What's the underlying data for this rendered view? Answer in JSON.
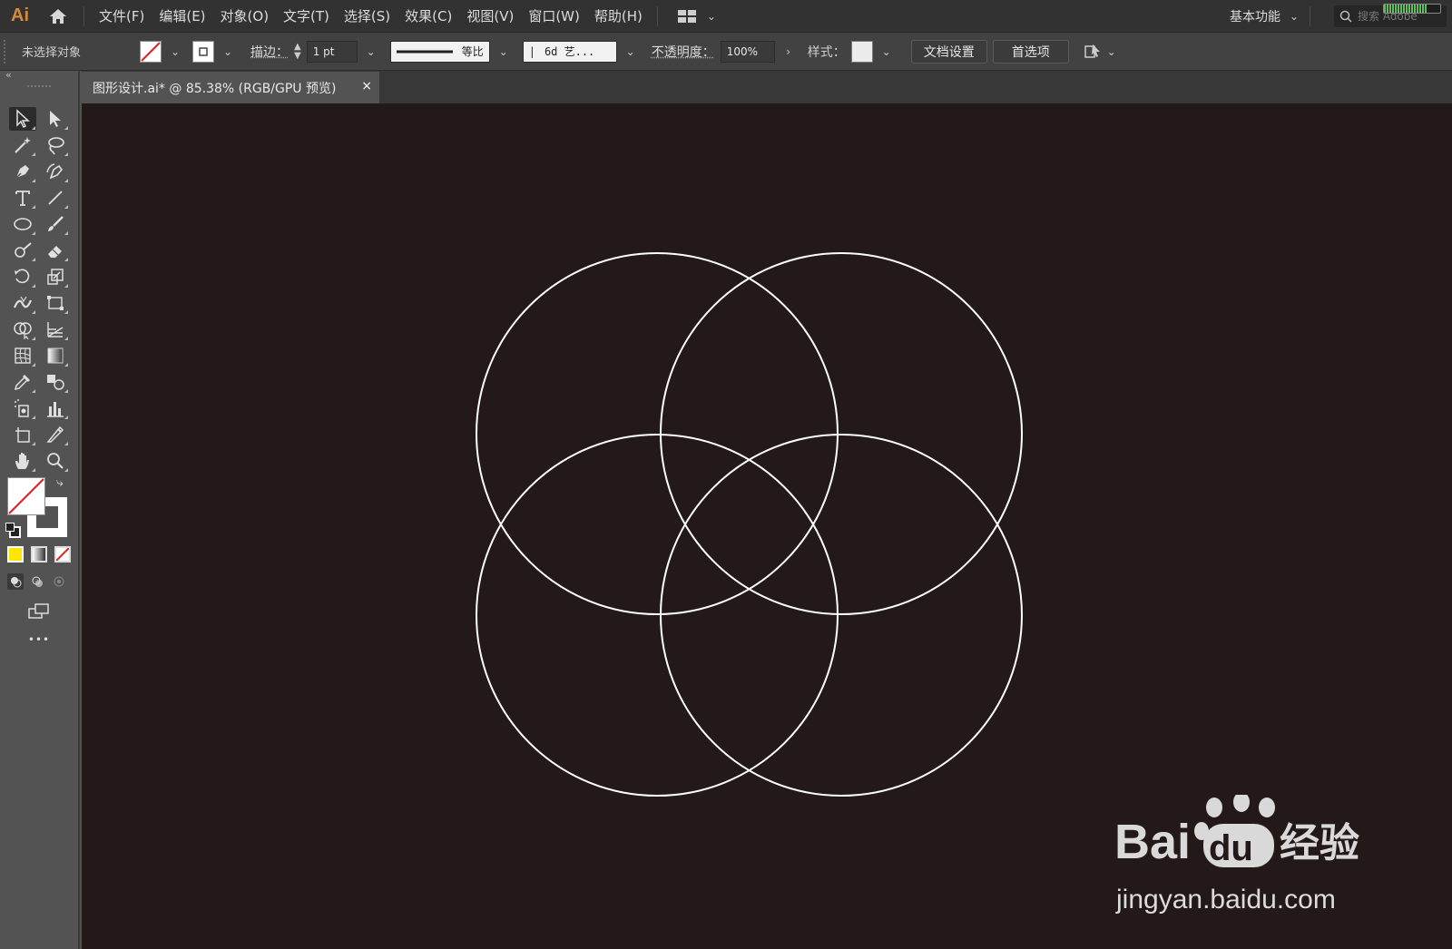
{
  "app": {
    "logo": "Ai"
  },
  "menu": [
    "文件(F)",
    "编辑(E)",
    "对象(O)",
    "文字(T)",
    "选择(S)",
    "效果(C)",
    "视图(V)",
    "窗口(W)",
    "帮助(H)"
  ],
  "workspace": {
    "label": "基本功能"
  },
  "search": {
    "placeholder": "搜索 Adobe"
  },
  "control_bar": {
    "selection": "未选择对象",
    "stroke_label": "描边：",
    "stroke_weight": "1 pt",
    "stroke_profile": "等比",
    "brush": "6d 艺...",
    "opacity_label": "不透明度：",
    "opacity_value": "100%",
    "style_label": "样式：",
    "doc_setup": "文档设置",
    "preferences": "首选项"
  },
  "document_tab": {
    "title": "图形设计.ai* @ 85.38% (RGB/GPU 预览)",
    "close": "×"
  },
  "toolbar": {
    "more": "•••"
  },
  "canvas": {
    "background": "#231918",
    "stroke_color": "#ffffff"
  },
  "watermark": {
    "brand": "Bai du 经验",
    "url": "jingyan.baidu.com"
  },
  "colors": {
    "accent_logo": "#d88a3a",
    "fill_yellow": "#ffe500",
    "none_red": "#e02020"
  }
}
